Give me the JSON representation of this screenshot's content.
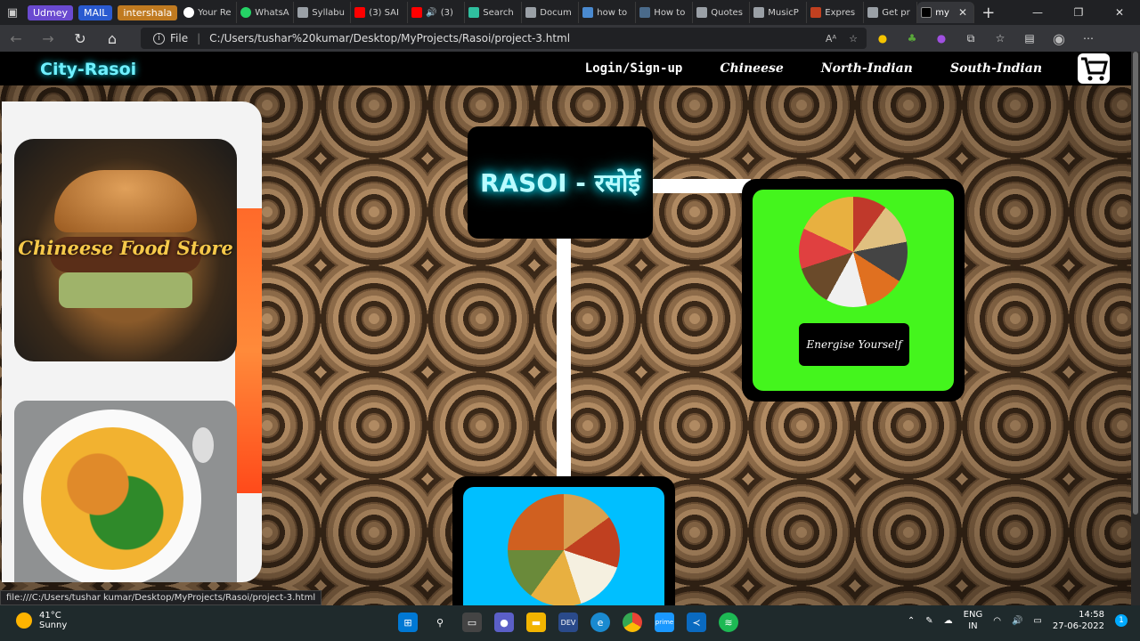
{
  "browser": {
    "tabs": [
      {
        "label": "Udmey",
        "type": "bookmark",
        "color": "#6a4ad0"
      },
      {
        "label": "MAIL",
        "type": "bookmark",
        "color": "#2a5ad0"
      },
      {
        "label": "intershala",
        "type": "bookmark",
        "color": "#c07a20"
      },
      {
        "label": "Your Re",
        "type": "tab",
        "icon": "github-icon",
        "color": "#ffffff"
      },
      {
        "label": "WhatsA",
        "type": "tab",
        "icon": "whatsapp-icon",
        "color": "#25d366"
      },
      {
        "label": "Syllabu",
        "type": "tab",
        "icon": "doc-icon",
        "color": "#9aa0a6"
      },
      {
        "label": "(3) SAI",
        "type": "tab",
        "icon": "youtube-icon",
        "color": "#ff0000"
      },
      {
        "label": "(3)",
        "type": "tab",
        "icon": "youtube-icon",
        "color": "#ff0000"
      },
      {
        "label": "Search",
        "type": "tab",
        "icon": "search-icon",
        "color": "#2fbf9f"
      },
      {
        "label": "Docum",
        "type": "tab",
        "icon": "doc-icon",
        "color": "#9aa0a6"
      },
      {
        "label": "how to",
        "type": "tab",
        "icon": "search-icon",
        "color": "#4a8ad0"
      },
      {
        "label": "How to",
        "type": "tab",
        "icon": "p-icon",
        "color": "#4a6a8a"
      },
      {
        "label": "Quotes",
        "type": "tab",
        "icon": "doc-icon",
        "color": "#9aa0a6"
      },
      {
        "label": "MusicP",
        "type": "tab",
        "icon": "doc-icon",
        "color": "#9aa0a6"
      },
      {
        "label": "Expres",
        "type": "tab",
        "icon": "film-icon",
        "color": "#c04020"
      },
      {
        "label": "Get pr",
        "type": "tab",
        "icon": "doc-icon",
        "color": "#9aa0a6"
      },
      {
        "label": "my",
        "type": "active",
        "icon": "cr-icon",
        "color": "#000000"
      }
    ],
    "new_tab": "+",
    "window_controls": [
      "—",
      "❐",
      "✕"
    ],
    "file_label": "File",
    "url": "C:/Users/tushar%20kumar/Desktop/MyProjects/Rasoi/project-3.html",
    "status_url": "file:///C:/Users/tushar kumar/Desktop/MyProjects/Rasoi/project-3.html"
  },
  "site": {
    "brand": "City-Rasoi",
    "nav": {
      "login": "Login/Sign-up",
      "links": [
        "Chineese",
        "North-Indian",
        "South-Indian"
      ]
    },
    "title": "RASOI - रसोई",
    "left_cards": {
      "card1_title": "Chineese Food Store"
    },
    "green_card": {
      "button": "Energise Yourself",
      "color": "#44f51d"
    },
    "blue_card": {
      "color": "#00bfff"
    },
    "accent": "#00e5ff"
  },
  "taskbar": {
    "weather_temp": "41°C",
    "weather_desc": "Sunny",
    "lang_1": "ENG",
    "lang_2": "IN",
    "time": "14:58",
    "date": "27-06-2022",
    "notifications": "1",
    "apps": [
      "windows-start-icon",
      "search-icon",
      "task-view-icon",
      "teams-icon",
      "file-explorer-icon",
      "dev-icon",
      "edge-icon",
      "chrome-icon",
      "prime-video-icon",
      "vscode-icon",
      "spotify-icon"
    ]
  }
}
